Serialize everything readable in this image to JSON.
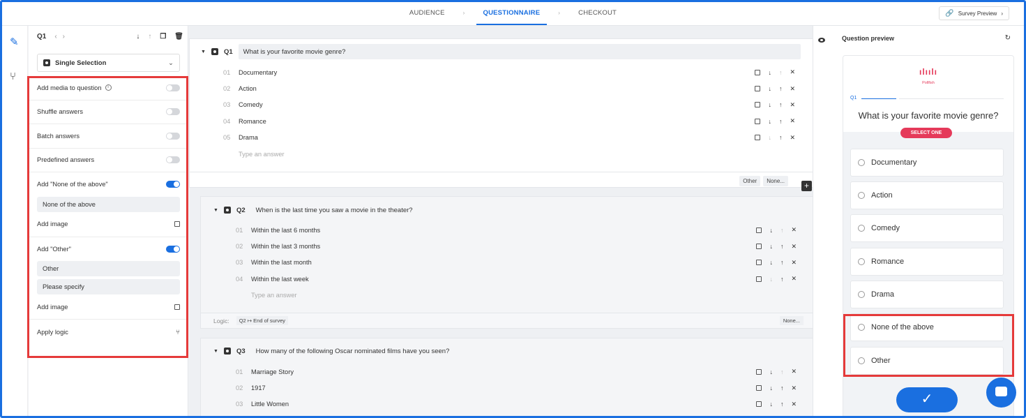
{
  "topbar": {
    "steps": [
      "AUDIENCE",
      "QUESTIONNAIRE",
      "CHECKOUT"
    ],
    "active_step": "QUESTIONNAIRE",
    "preview_label": "Survey Preview"
  },
  "settings": {
    "question_id": "Q1",
    "question_type": "Single Selection",
    "options": {
      "add_media": "Add media to question",
      "shuffle": "Shuffle answers",
      "batch": "Batch answers",
      "predefined": "Predefined answers",
      "add_none": "Add \"None of the above\"",
      "none_value": "None of the above",
      "add_image": "Add image",
      "add_other": "Add \"Other\"",
      "other_value": "Other",
      "other_placeholder": "Please specify",
      "add_image_2": "Add image",
      "apply_logic": "Apply logic"
    },
    "toggles": {
      "add_media": false,
      "shuffle": false,
      "batch": false,
      "predefined": false,
      "add_none": true,
      "add_other": true
    }
  },
  "questions": [
    {
      "id": "Q1",
      "title": "What is your favorite movie genre?",
      "answers": [
        {
          "num": "01",
          "text": "Documentary"
        },
        {
          "num": "02",
          "text": "Action"
        },
        {
          "num": "03",
          "text": "Comedy"
        },
        {
          "num": "04",
          "text": "Romance"
        },
        {
          "num": "05",
          "text": "Drama"
        }
      ],
      "placeholder": "Type an answer",
      "footer": [
        "Other",
        "None..."
      ]
    },
    {
      "id": "Q2",
      "title": "When is the last time you saw a movie in the theater?",
      "answers": [
        {
          "num": "01",
          "text": "Within the last 6 months"
        },
        {
          "num": "02",
          "text": "Within the last 3 months"
        },
        {
          "num": "03",
          "text": "Within the last month"
        },
        {
          "num": "04",
          "text": "Within the last week"
        }
      ],
      "placeholder": "Type an answer",
      "logic_label": "Logic:",
      "logic_rule": "Q2 ↦ End of survey",
      "logic_none": "None..."
    },
    {
      "id": "Q3",
      "title": "How many of the following Oscar nominated films have you seen?",
      "answers": [
        {
          "num": "01",
          "text": "Marriage Story"
        },
        {
          "num": "02",
          "text": "1917"
        },
        {
          "num": "03",
          "text": "Little Women"
        }
      ]
    }
  ],
  "preview": {
    "title": "Question preview",
    "brand": "Pollfish",
    "q_label": "Q1",
    "question": "What is your favorite movie genre?",
    "select_badge": "SELECT ONE",
    "answers": [
      "Documentary",
      "Action",
      "Comedy",
      "Romance",
      "Drama",
      "None of the above",
      "Other"
    ],
    "submit_icon": "checkmark-icon"
  },
  "colors": {
    "accent": "#1a6fe0",
    "brand": "#e53a5a",
    "highlight": "#e53a3a"
  }
}
